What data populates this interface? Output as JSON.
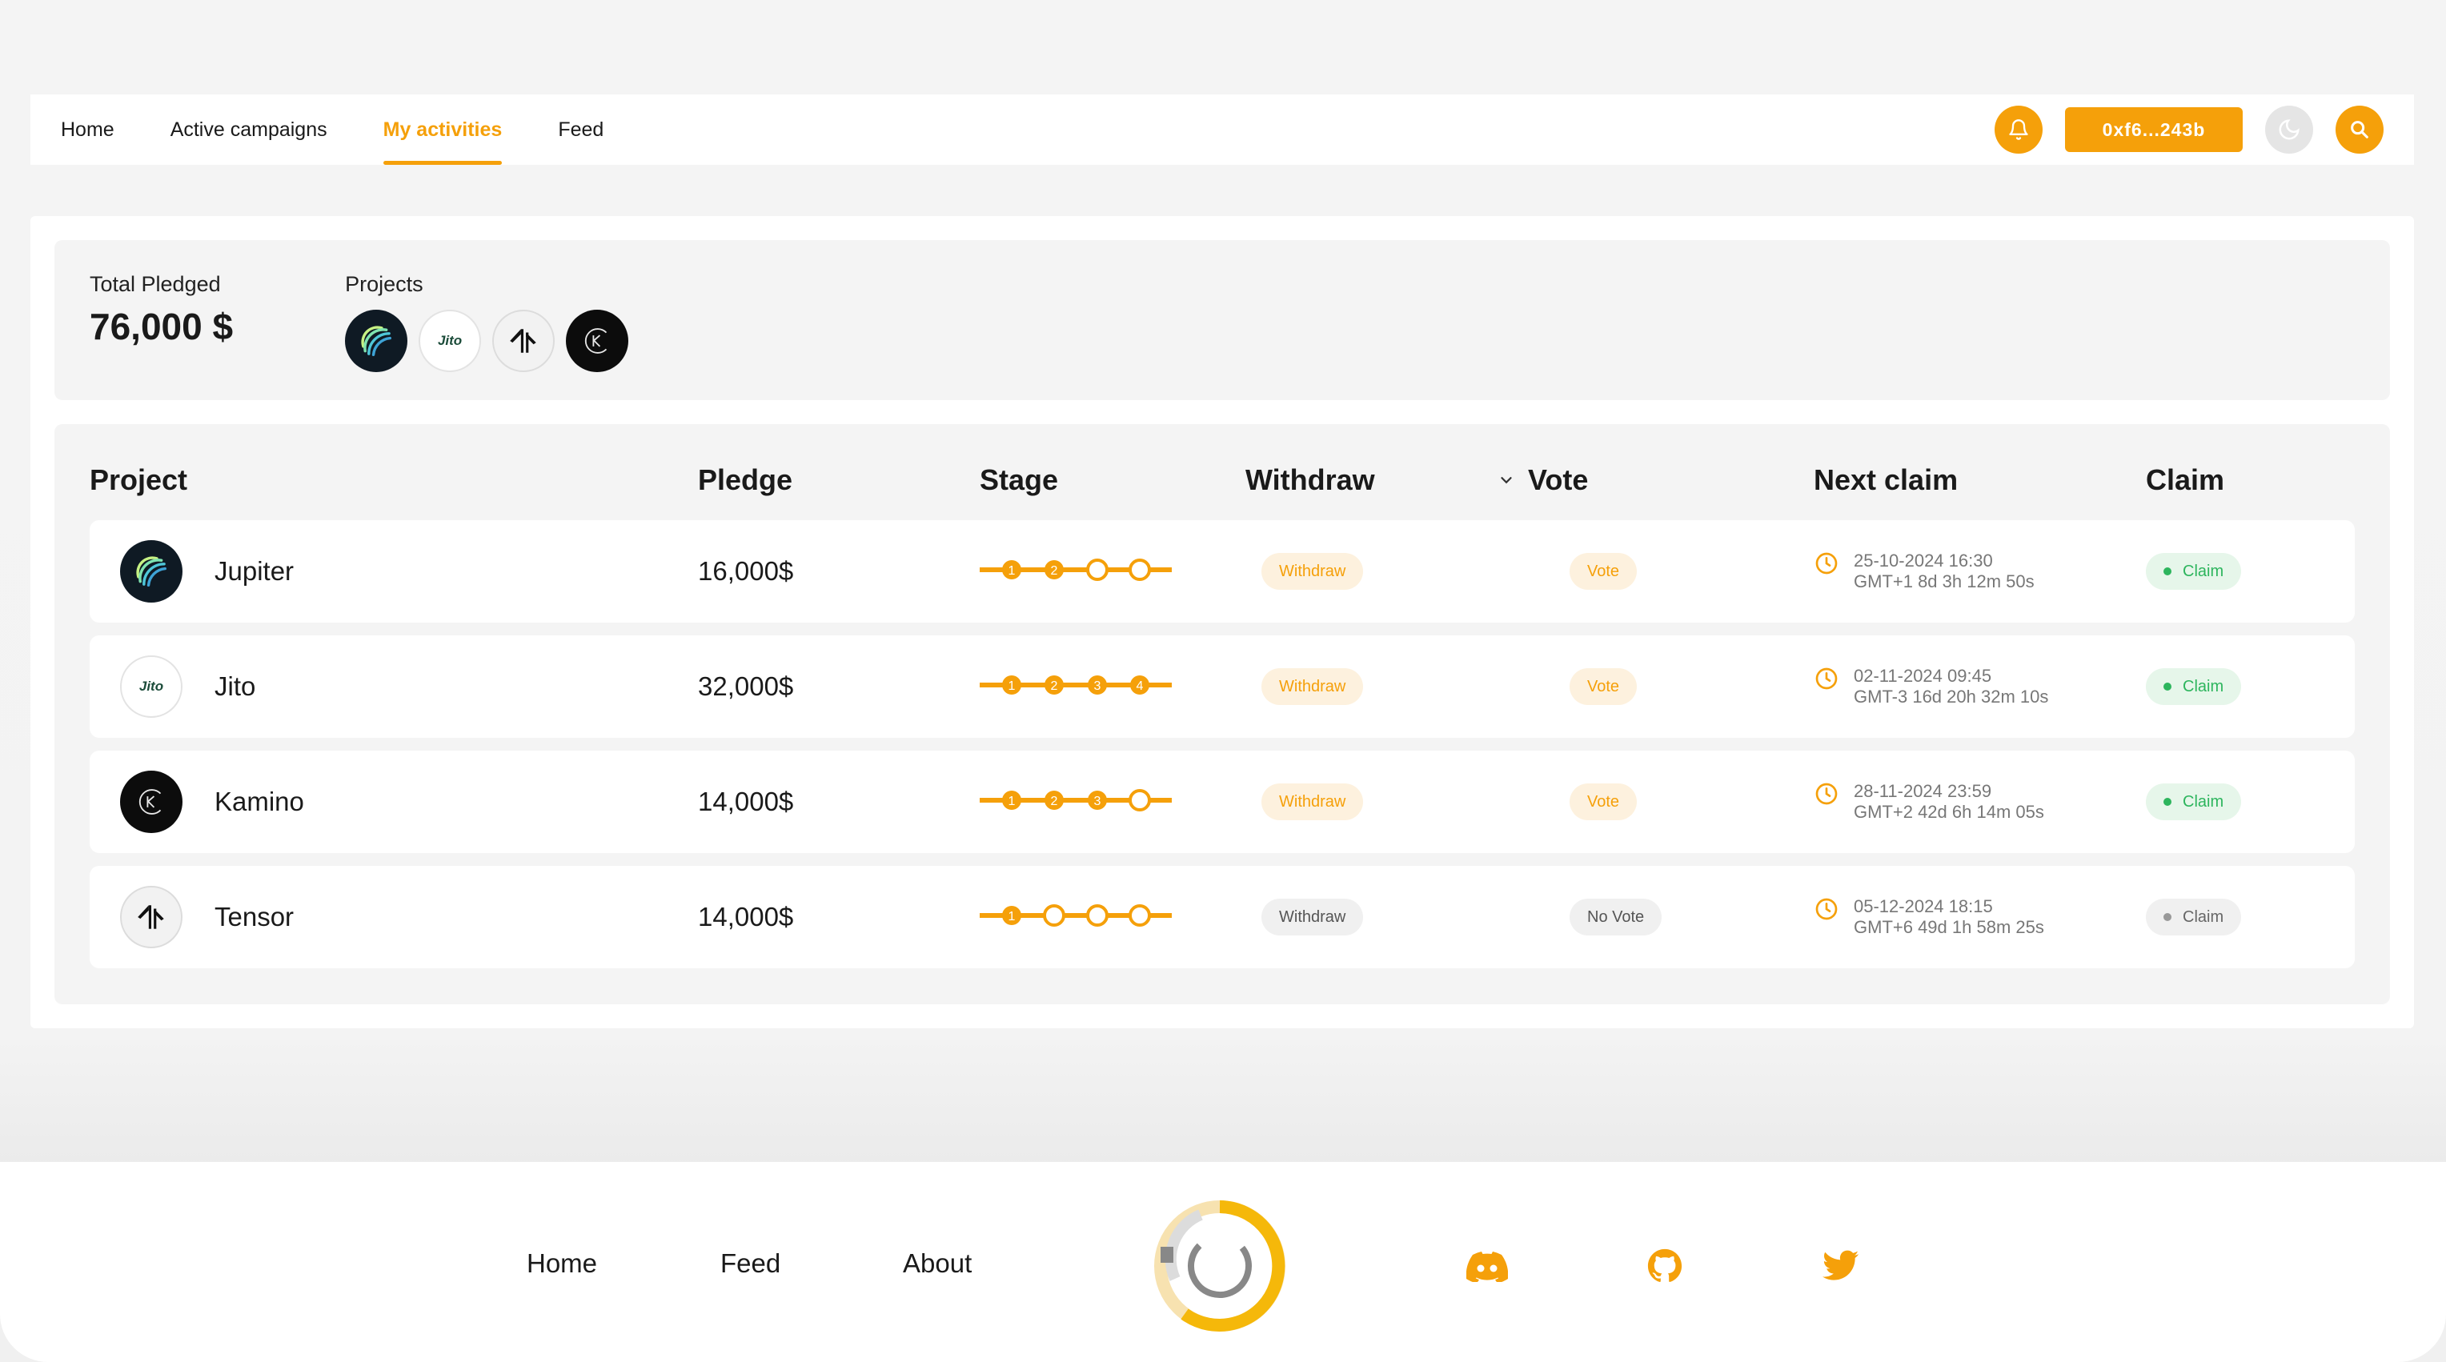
{
  "nav": {
    "links": [
      "Home",
      "Active campaigns",
      "My activities",
      "Feed"
    ],
    "active_index": 2,
    "wallet_label": "0xf6...243b"
  },
  "summary": {
    "total_label": "Total Pledged",
    "total_value": "76,000 $",
    "projects_label": "Projects"
  },
  "table": {
    "headers": {
      "project": "Project",
      "pledge": "Pledge",
      "stage": "Stage",
      "withdraw": "Withdraw",
      "vote": "Vote",
      "next_claim": "Next claim",
      "claim": "Claim"
    },
    "rows": [
      {
        "name": "Jupiter",
        "logo": "jupiter-logo",
        "pledge": "16,000$",
        "stage_completed": 2,
        "stage_total": 4,
        "withdraw": "Withdraw",
        "withdraw_active": true,
        "vote": "Vote",
        "vote_active": true,
        "date": "25-10-2024 16:30",
        "countdown": "GMT+1 8d 3h 12m 50s",
        "claim": "Claim",
        "claim_active": true
      },
      {
        "name": "Jito",
        "logo": "jito-logo",
        "pledge": "32,000$",
        "stage_completed": 4,
        "stage_total": 4,
        "withdraw": "Withdraw",
        "withdraw_active": true,
        "vote": "Vote",
        "vote_active": true,
        "date": "02-11-2024 09:45",
        "countdown": "GMT-3 16d 20h 32m 10s",
        "claim": "Claim",
        "claim_active": true
      },
      {
        "name": "Kamino",
        "logo": "kamino-logo",
        "pledge": "14,000$",
        "stage_completed": 3,
        "stage_total": 4,
        "withdraw": "Withdraw",
        "withdraw_active": true,
        "vote": "Vote",
        "vote_active": true,
        "date": "28-11-2024 23:59",
        "countdown": "GMT+2 42d 6h 14m 05s",
        "claim": "Claim",
        "claim_active": true
      },
      {
        "name": "Tensor",
        "logo": "tensor-logo",
        "pledge": "14,000$",
        "stage_completed": 1,
        "stage_total": 4,
        "withdraw": "Withdraw",
        "withdraw_active": false,
        "vote": "No Vote",
        "vote_active": false,
        "date": "05-12-2024 18:15",
        "countdown": "GMT+6 49d 1h 58m 25s",
        "claim": "Claim",
        "claim_active": false
      }
    ]
  },
  "footer": {
    "links": [
      "Home",
      "Feed",
      "About"
    ],
    "socials": [
      "discord-icon",
      "github-icon",
      "twitter-icon"
    ]
  },
  "colors": {
    "accent": "#f5a00a",
    "claim_green": "#2db55d"
  },
  "jito_logo_text": "Jito"
}
